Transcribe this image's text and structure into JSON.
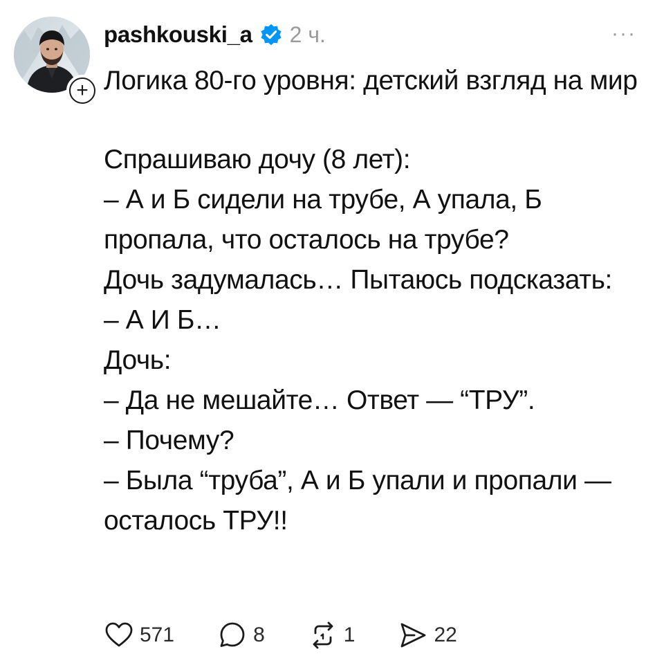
{
  "post": {
    "username": "pashkouski_a",
    "time": "2 ч.",
    "more_label": "···",
    "title": "Логика 80-го уровня: детский взгляд на мир",
    "lines": [
      "Спрашиваю дочу (8 лет):",
      "– А и Б сидели на трубе, А упала, Б пропала, что осталось на трубе?",
      "Дочь задумалась… Пытаюсь подсказать:",
      "– А И Б…",
      "Дочь:",
      "– Да не мешайте… Ответ — “ТРУ”.",
      "– Почему?",
      "– Была “труба”, А и Б упали и пропали — осталось ТРУ!!"
    ],
    "follow_label": "+"
  },
  "actions": {
    "likes": "571",
    "comments": "8",
    "reposts": "1",
    "shares": "22"
  },
  "icons": {
    "verified": "verified-badge-icon",
    "like": "heart-icon",
    "comment": "comment-bubble-icon",
    "repost": "repost-icon",
    "share": "send-icon"
  },
  "colors": {
    "verified": "#0095f6",
    "muted": "#9a9a9a",
    "text": "#111111"
  }
}
